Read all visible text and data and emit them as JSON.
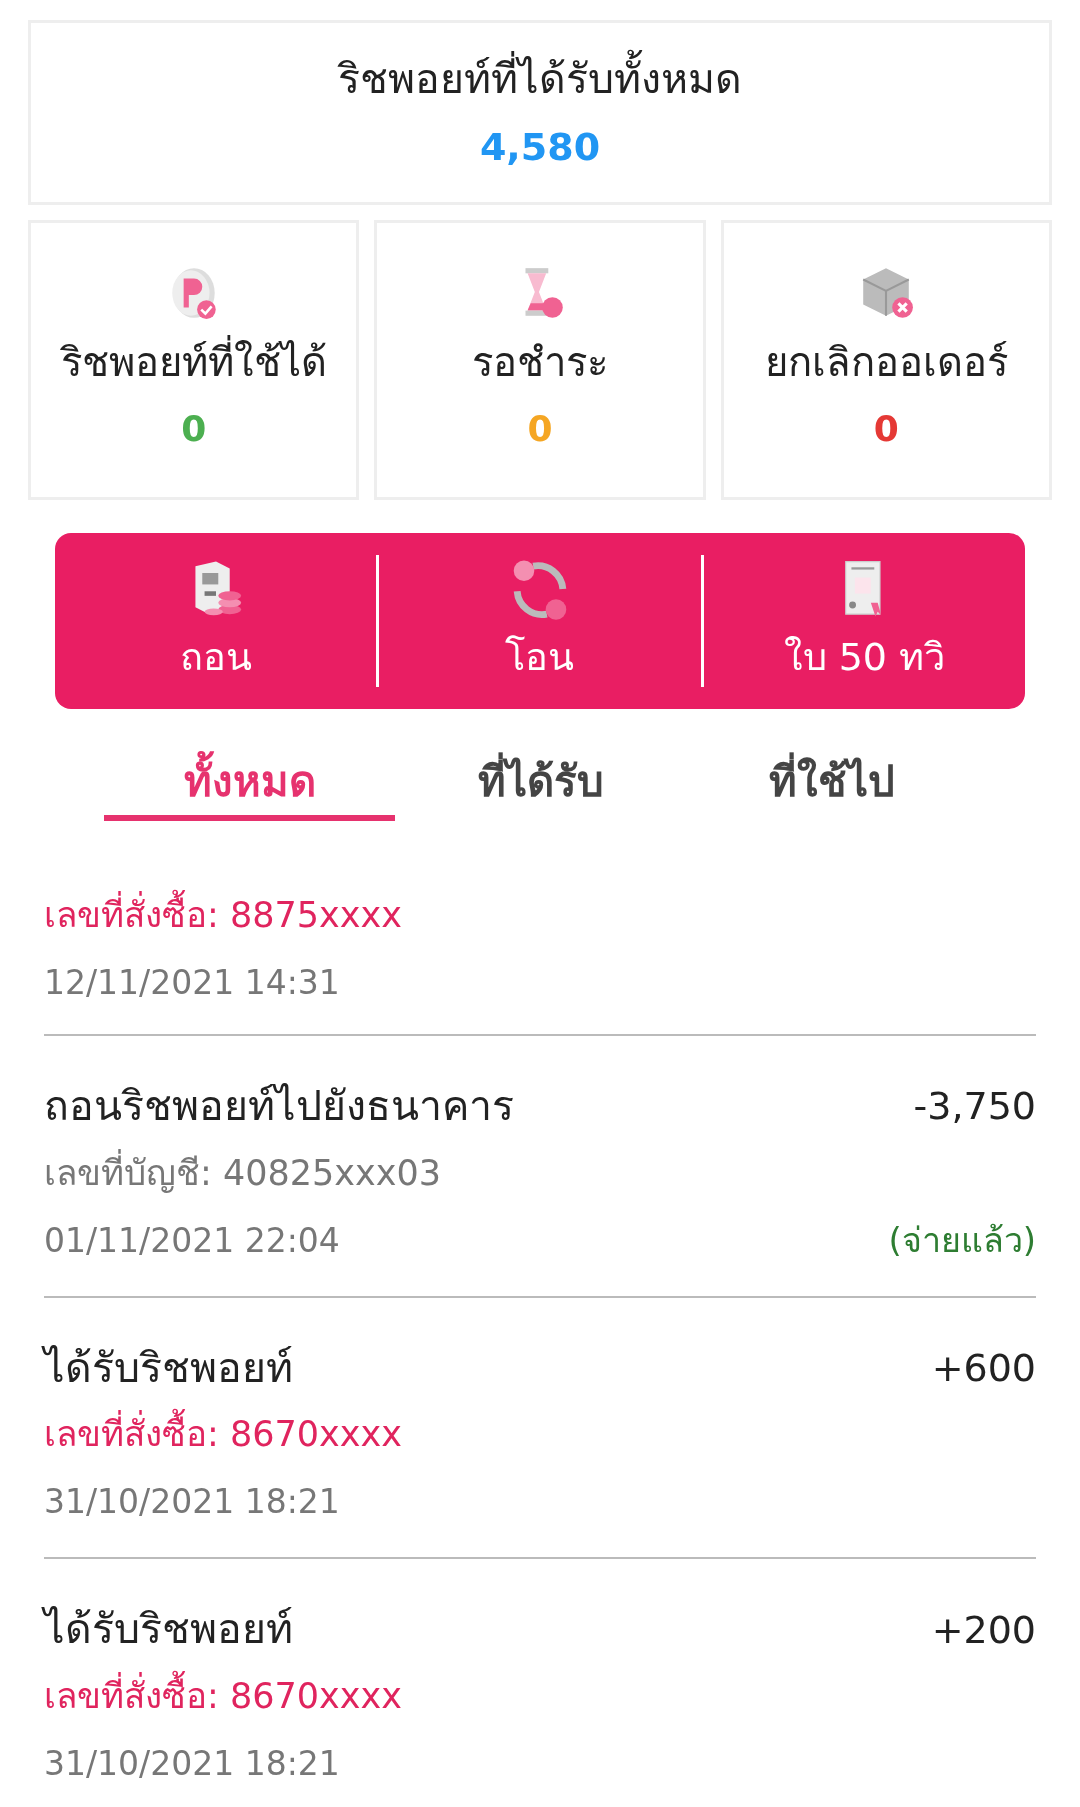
{
  "summary": {
    "title": "ริชพอยท์ที่ได้รับทั้งหมด",
    "value": "4,580"
  },
  "stats": [
    {
      "kind": "points",
      "label": "ริชพอยท์ที่ใช้ได้",
      "value": "0",
      "color": "#4caf50"
    },
    {
      "kind": "pending",
      "label": "รอชำระ",
      "value": "0",
      "color": "#f5a623"
    },
    {
      "kind": "cancelled",
      "label": "ยกเลิกออเดอร์",
      "value": "0",
      "color": "#e53935"
    }
  ],
  "actions": [
    {
      "kind": "withdraw",
      "label": "ถอน"
    },
    {
      "kind": "transfer",
      "label": "โอน"
    },
    {
      "kind": "certificate",
      "label": "ใบ 50 ทวิ"
    }
  ],
  "tabs": [
    {
      "label": "ทั้งหมด",
      "selected": true
    },
    {
      "label": "ที่ได้รับ",
      "selected": false
    },
    {
      "label": "ที่ใช้ไป",
      "selected": false
    }
  ],
  "transactions": [
    {
      "kind": "order",
      "detail": "เลขที่สั่งซื้อ: 8875xxxx",
      "date": "12/11/2021 14:31"
    },
    {
      "title": "ถอนริชพอยท์ไปยังธนาคาร",
      "amount": "-3,750",
      "kind": "account",
      "detail": "เลขที่บัญชี: 40825xxx03",
      "date": "01/11/2021 22:04",
      "status": "(จ่ายแล้ว)"
    },
    {
      "title": "ได้รับริชพอยท์",
      "amount": "+600",
      "kind": "order",
      "detail": "เลขที่สั่งซื้อ: 8670xxxx",
      "date": "31/10/2021 18:21"
    },
    {
      "title": "ได้รับริชพอยท์",
      "amount": "+200",
      "kind": "order",
      "detail": "เลขที่สั่งซื้อ: 8670xxxx",
      "date": "31/10/2021 18:21"
    }
  ]
}
